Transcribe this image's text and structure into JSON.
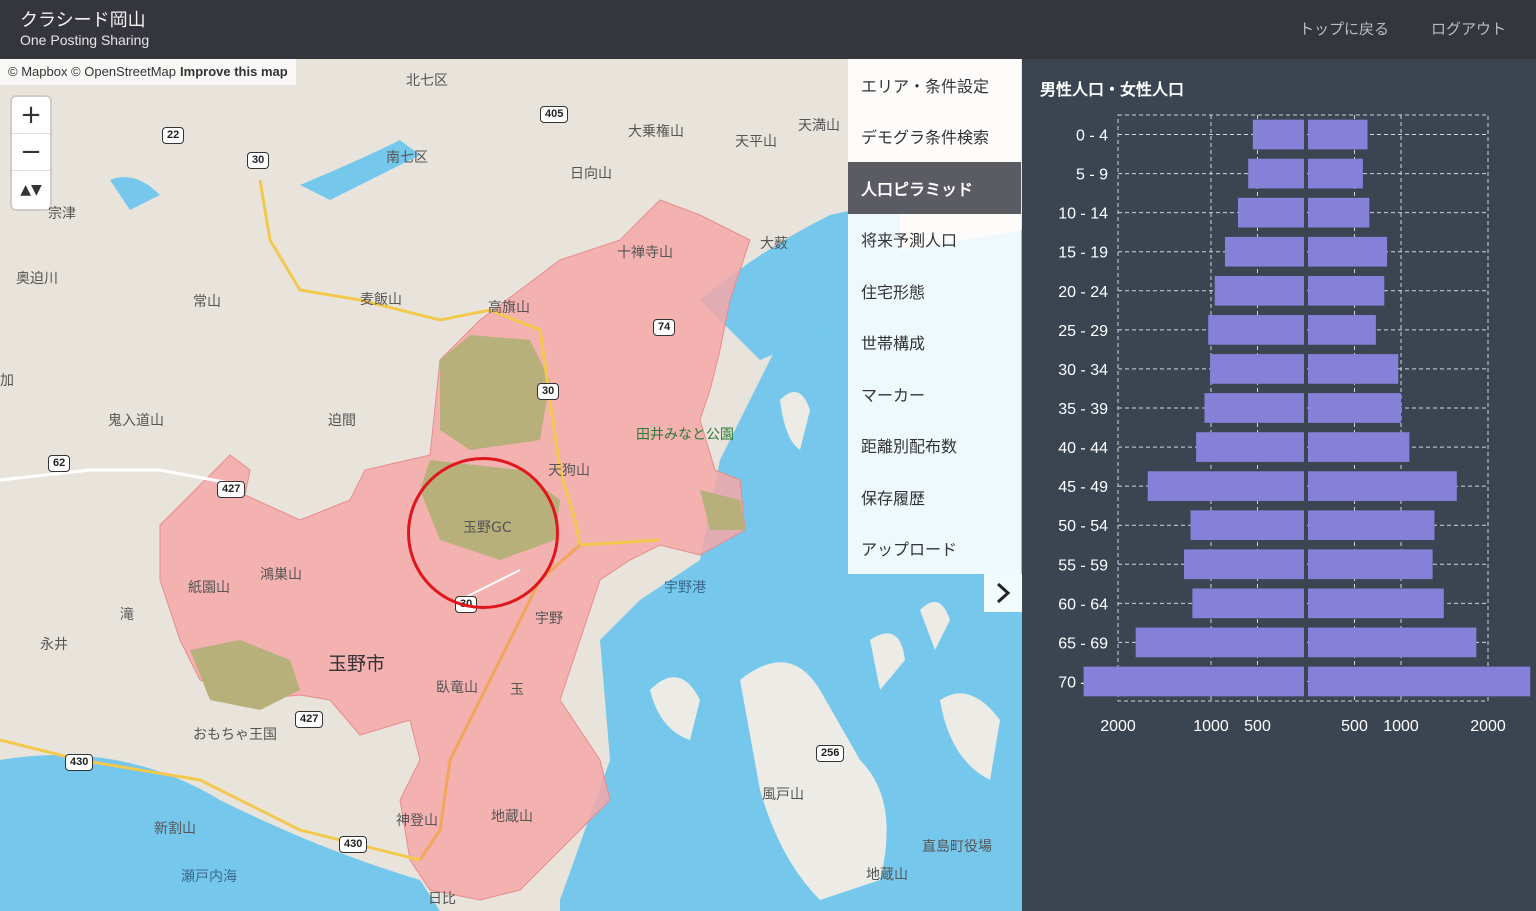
{
  "header": {
    "title": "クラシード岡山",
    "subtitle": "One Posting Sharing",
    "nav_top": "トップに戻る",
    "nav_logout": "ログアウト"
  },
  "map": {
    "attribution": "© Mapbox © OpenStreetMap",
    "improve": "Improve this map",
    "zoom_in": "+",
    "zoom_out": "−",
    "compass": "▲▼",
    "labels": [
      "北七区",
      "南七区",
      "大乗権山",
      "天平山",
      "天満山",
      "日向山",
      "宗津",
      "奥迫川",
      "常山",
      "麦飯山",
      "十禅寺山",
      "大薮",
      "高旗山",
      "鬼入道山",
      "迫間",
      "田井みなと公園",
      "天狗山",
      "玉野GC",
      "紙園山",
      "鴻巣山",
      "滝",
      "永井",
      "玉野市",
      "宇野",
      "宇野港",
      "臥竜山",
      "玉",
      "おもちゃ王国",
      "新割山",
      "瀬戸内海",
      "神登山",
      "地蔵山",
      "風戸山",
      "直島町役場",
      "地蔵山",
      "日比",
      "加"
    ],
    "roads": [
      "405",
      "22",
      "30",
      "74",
      "30",
      "62",
      "427",
      "427",
      "430",
      "430",
      "256",
      "30"
    ],
    "marker_note": "玉野GC"
  },
  "menu": {
    "items": [
      "エリア・条件設定",
      "デモグラ条件検索",
      "人口ピラミッド",
      "将来予測人口",
      "住宅形態",
      "世帯構成",
      "マーカー",
      "距離別配布数",
      "保存履歴",
      "アップロード"
    ],
    "active_index": 2,
    "toggle_icon": "chevron-right-icon"
  },
  "chart_data": {
    "type": "bar",
    "title": "男性人口・女性人口",
    "categories": [
      "0 - 4",
      "5 - 9",
      "10 - 14",
      "15 - 19",
      "20 - 24",
      "25 - 29",
      "30 - 34",
      "35 - 39",
      "40 - 44",
      "45 - 49",
      "50 - 54",
      "55 - 59",
      "60 - 64",
      "65 - 69",
      "70 - 74"
    ],
    "series": [
      {
        "values": [
          550,
          600,
          710,
          850,
          960,
          1030,
          1010,
          1070,
          1160,
          1680,
          1220,
          1290,
          1200,
          1810,
          2370
        ]
      },
      {
        "values": [
          640,
          590,
          660,
          850,
          820,
          730,
          970,
          1000,
          1090,
          1600,
          1360,
          1340,
          1460,
          1810,
          2390
        ]
      }
    ],
    "x_tick_labels": [
      "2000",
      "1000",
      "500",
      "500",
      "1000",
      "2000"
    ],
    "color": "#8780d8",
    "grid": true
  }
}
